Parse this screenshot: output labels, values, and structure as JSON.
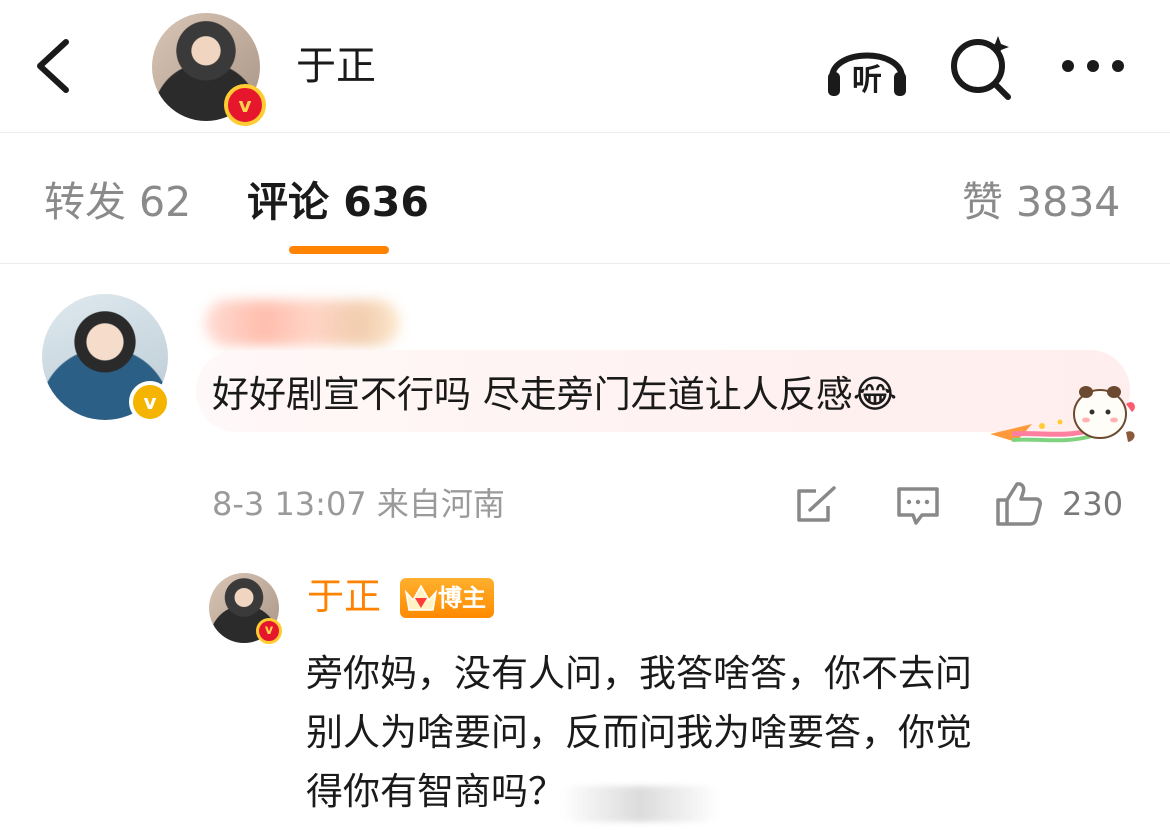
{
  "header": {
    "title": "于正",
    "listen_label": "听"
  },
  "tabs": [
    {
      "label": "转发 62"
    },
    {
      "label": "评论 636"
    },
    {
      "label": "赞 3834"
    }
  ],
  "comment": {
    "text": "好好剧宣不行吗 尽走旁门左道让人反感",
    "emoji": "😂",
    "meta": "8-3 13:07 来自河南",
    "like_count": "230"
  },
  "reply": {
    "name": "于正",
    "badge_label": "博主",
    "lines": [
      "旁你妈，没有人问，我答啥答，你不去问",
      "别人为啥要问，反而问我为啥要答，你觉",
      "得你有智商吗？"
    ]
  },
  "colors": {
    "accent": "#ff8200",
    "verified_red": "#e6162d",
    "verified_gold": "#f5b400"
  }
}
